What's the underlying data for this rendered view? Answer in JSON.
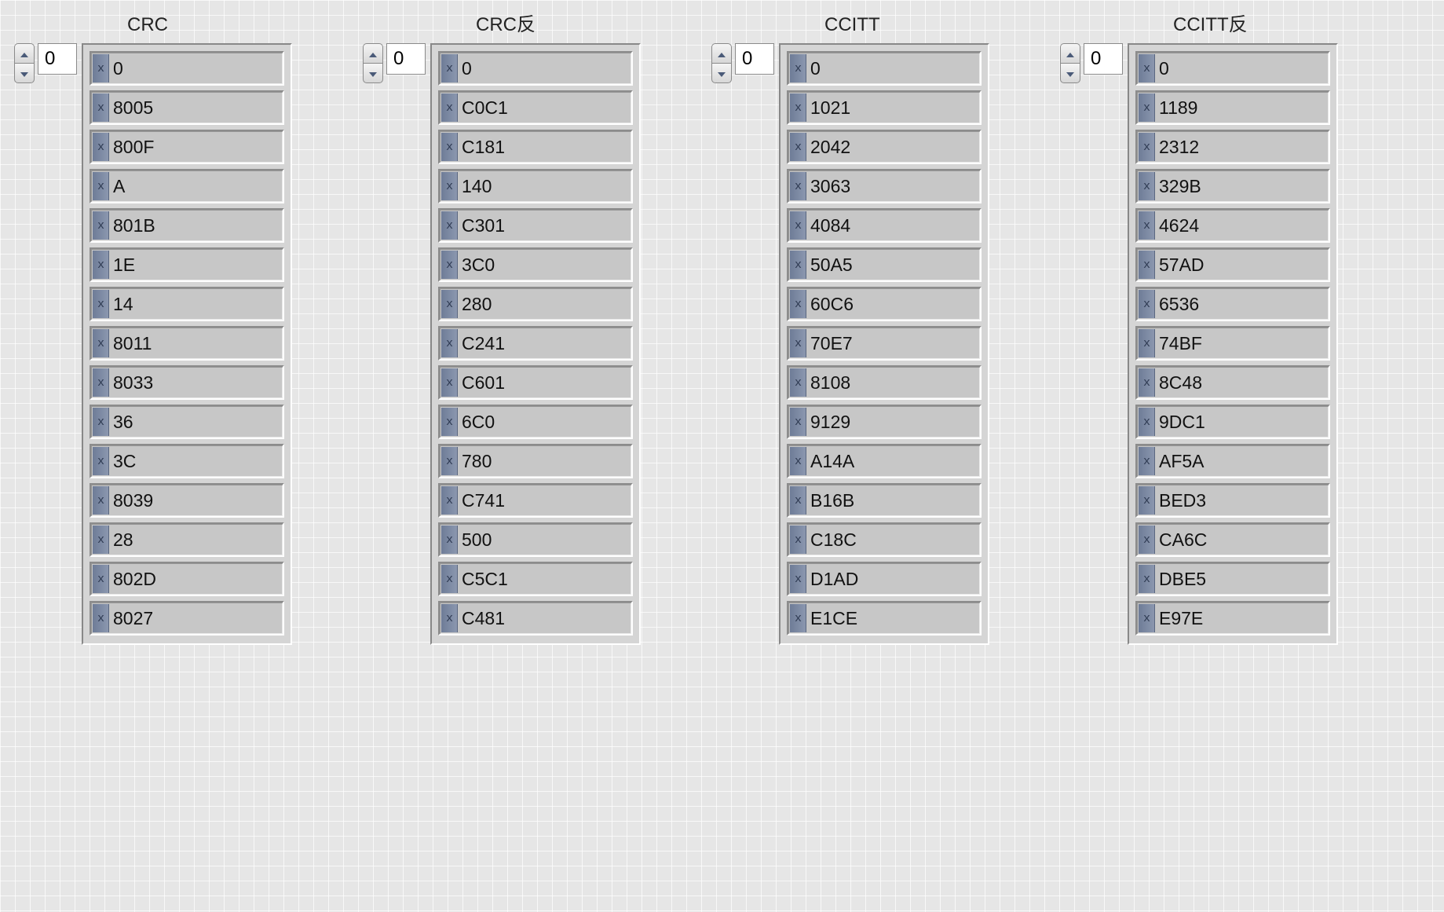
{
  "radix_prefix": "x",
  "columns": [
    {
      "id": "crc",
      "label": "CRC",
      "index_value": "0",
      "values": [
        "0",
        "8005",
        "800F",
        "A",
        "801B",
        "1E",
        "14",
        "8011",
        "8033",
        "36",
        "3C",
        "8039",
        "28",
        "802D",
        "8027"
      ]
    },
    {
      "id": "crc_rev",
      "label": "CRC反",
      "index_value": "0",
      "values": [
        "0",
        "C0C1",
        "C181",
        "140",
        "C301",
        "3C0",
        "280",
        "C241",
        "C601",
        "6C0",
        "780",
        "C741",
        "500",
        "C5C1",
        "C481"
      ]
    },
    {
      "id": "ccitt",
      "label": "CCITT",
      "index_value": "0",
      "values": [
        "0",
        "1021",
        "2042",
        "3063",
        "4084",
        "50A5",
        "60C6",
        "70E7",
        "8108",
        "9129",
        "A14A",
        "B16B",
        "C18C",
        "D1AD",
        "E1CE"
      ]
    },
    {
      "id": "ccitt_rev",
      "label": "CCITT反",
      "index_value": "0",
      "values": [
        "0",
        "1189",
        "2312",
        "329B",
        "4624",
        "57AD",
        "6536",
        "74BF",
        "8C48",
        "9DC1",
        "AF5A",
        "BED3",
        "CA6C",
        "DBE5",
        "E97E"
      ]
    }
  ]
}
